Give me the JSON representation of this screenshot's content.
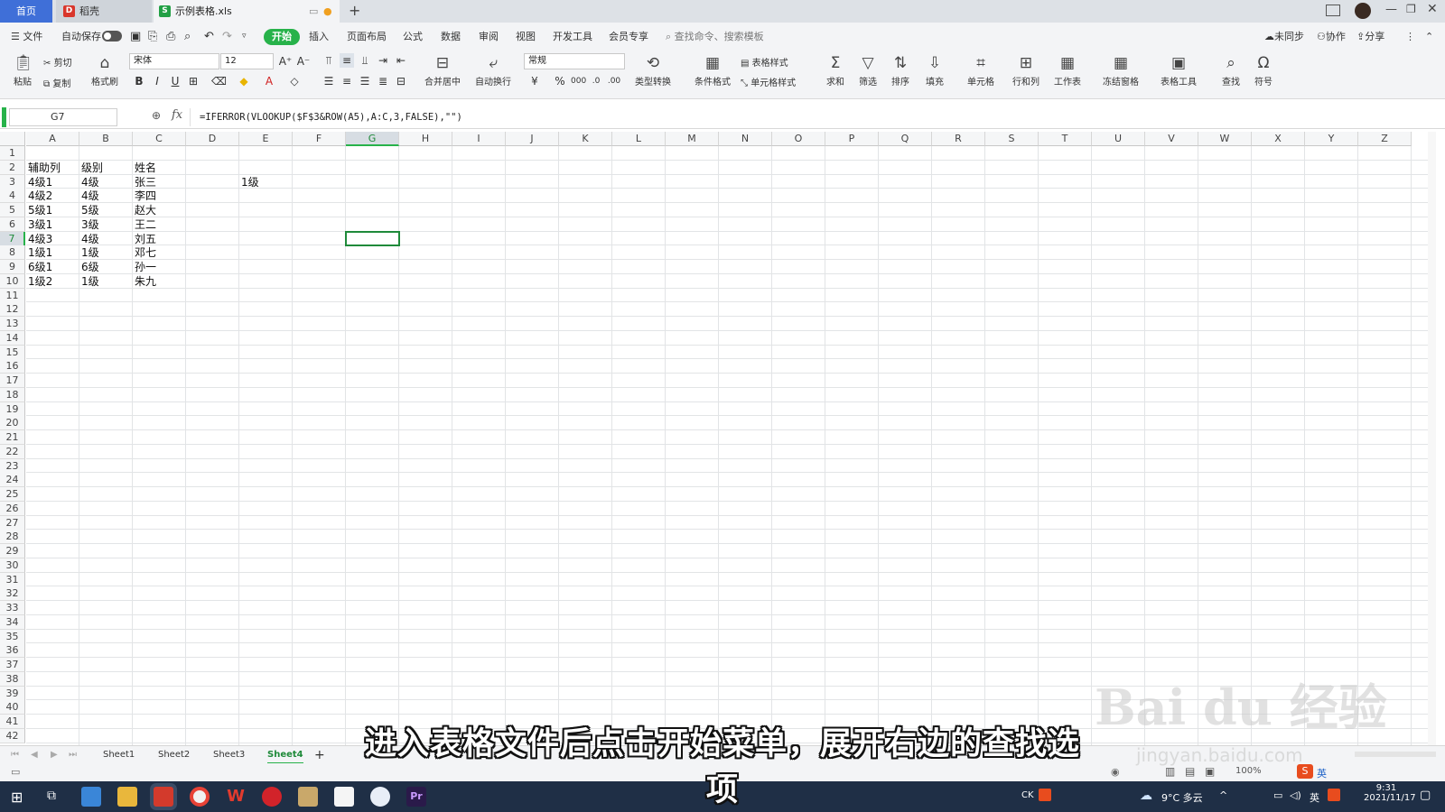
{
  "tabs": {
    "home": "首页",
    "daoke": "稻壳",
    "file": "示例表格.xls"
  },
  "menu": {
    "file": "文件",
    "autosave": "自动保存",
    "items": [
      "开始",
      "插入",
      "页面布局",
      "公式",
      "数据",
      "审阅",
      "视图",
      "开发工具",
      "会员专享"
    ],
    "search_placeholder": "查找命令、搜索模板",
    "sync": "未同步",
    "collab": "协作",
    "share": "分享"
  },
  "ribbon": {
    "paste": "粘贴",
    "cut": "剪切",
    "copy": "复制",
    "format_painter": "格式刷",
    "font_name": "宋体",
    "font_size": "12",
    "merge": "合并居中",
    "wrap": "自动换行",
    "number_format": "常规",
    "type_convert": "类型转换",
    "cond_format": "条件格式",
    "table_style": "表格样式",
    "cell_style": "单元格样式",
    "sum": "求和",
    "filter": "筛选",
    "sort": "排序",
    "fill": "填充",
    "cell": "单元格",
    "rowcol": "行和列",
    "worksheet": "工作表",
    "freeze": "冻结窗格",
    "table_tools": "表格工具",
    "find": "查找",
    "symbol": "符号"
  },
  "formula_bar": {
    "cell_ref": "G7",
    "fx": "fx",
    "formula": "=IFERROR(VLOOKUP($F$3&ROW(A5),A:C,3,FALSE),\"\")"
  },
  "columns": [
    "A",
    "B",
    "C",
    "D",
    "E",
    "F",
    "G",
    "H",
    "I",
    "J",
    "K",
    "L",
    "M",
    "N",
    "O",
    "P",
    "Q",
    "R",
    "S",
    "T",
    "U",
    "V",
    "W",
    "X",
    "Y",
    "Z"
  ],
  "rows": [
    "1",
    "2",
    "3",
    "4",
    "5",
    "6",
    "7",
    "8",
    "9",
    "10",
    "11",
    "12",
    "13",
    "14",
    "15",
    "16",
    "17",
    "18",
    "19",
    "20",
    "21",
    "22",
    "23",
    "24",
    "25",
    "26",
    "27",
    "28",
    "29",
    "30",
    "31",
    "32",
    "33",
    "34",
    "35",
    "36",
    "37",
    "38",
    "39",
    "40",
    "41",
    "42"
  ],
  "cells": {
    "A2": "辅助列",
    "B2": "级别",
    "C2": "姓名",
    "A3": "4级1",
    "B3": "4级",
    "C3": "张三",
    "E3": "1级",
    "A4": "4级2",
    "B4": "4级",
    "C4": "李四",
    "A5": "5级1",
    "B5": "5级",
    "C5": "赵大",
    "A6": "3级1",
    "B6": "3级",
    "C6": "王二",
    "A7": "4级3",
    "B7": "4级",
    "C7": "刘五",
    "A8": "1级1",
    "B8": "1级",
    "C8": "邓七",
    "A9": "6级1",
    "B9": "6级",
    "C9": "孙一",
    "A10": "1级2",
    "B10": "1级",
    "C10": "朱九"
  },
  "sheets": [
    "Sheet1",
    "Sheet2",
    "Sheet3",
    "Sheet4"
  ],
  "active_sheet": "Sheet4",
  "status": {
    "zoom": "100%",
    "lang": "英"
  },
  "taskbar": {
    "ck": "CK",
    "weather": "9°C 多云",
    "ime": "英",
    "time": "9:31",
    "date": "2021/11/17"
  },
  "subtitle": "进入表格文件后点击开始菜单，展开右边的查找选项",
  "watermark": {
    "brand": "Bai du 经验",
    "url": "jingyan.baidu.com"
  },
  "colors": {
    "accent": "#27b24a",
    "selection": "#1f8a3a",
    "tab_home": "#3f6fd8"
  }
}
